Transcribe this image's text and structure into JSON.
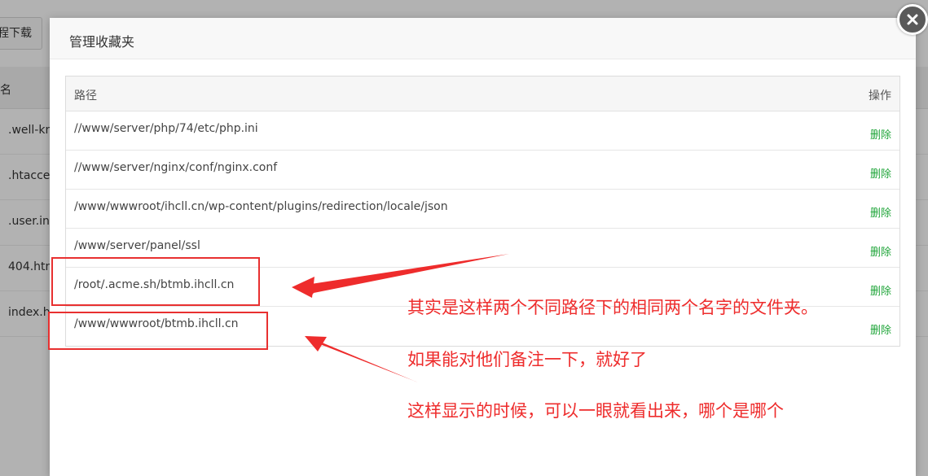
{
  "background": {
    "toolbar_button_label": "程下载",
    "table_header_name": "名",
    "rows": [
      ".well-kn",
      ".htacce",
      ".user.ini",
      "404.htm",
      "index.h"
    ]
  },
  "modal": {
    "title": "管理收藏夹",
    "table": {
      "columns": [
        "路径",
        "操作"
      ],
      "rows": [
        {
          "path": "//www/server/php/74/etc/php.ini",
          "action": "删除"
        },
        {
          "path": "//www/server/nginx/conf/nginx.conf",
          "action": "删除"
        },
        {
          "path": "/www/wwwroot/ihcll.cn/wp-content/plugins/redirection/locale/json",
          "action": "删除"
        },
        {
          "path": "/www/server/panel/ssl",
          "action": "删除"
        },
        {
          "path": "/root/.acme.sh/btmb.ihcll.cn",
          "action": "删除"
        },
        {
          "path": "/www/wwwroot/btmb.ihcll.cn",
          "action": "删除"
        }
      ]
    }
  },
  "annotations": {
    "line1": "其实是这样两个不同路径下的相同两个名字的文件夹。",
    "line2": "如果能对他们备注一下，就好了",
    "line3": "这样显示的时候，可以一眼就看出来，哪个是哪个"
  },
  "colors": {
    "accent_delete": "#20a53a",
    "annotation_red": "#ee2c2c"
  }
}
